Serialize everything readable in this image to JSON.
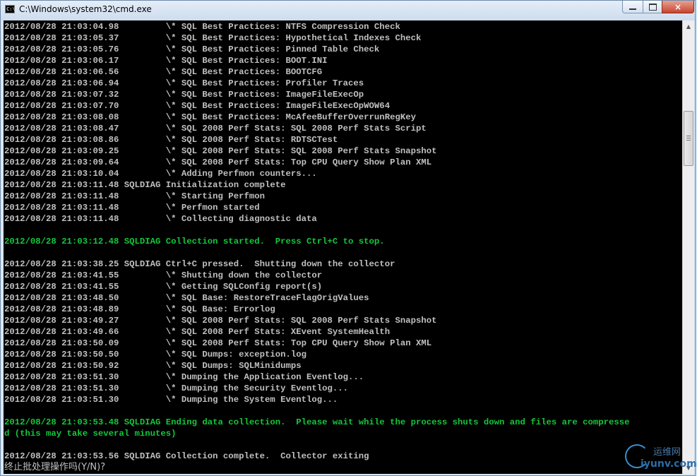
{
  "window": {
    "title": "C:\\Windows\\system32\\cmd.exe",
    "icon": "console-icon",
    "controls": {
      "minimize": "minimize-icon",
      "maximize": "maximize-icon",
      "close": "×"
    }
  },
  "console": {
    "lines": [
      {
        "text": "2012/08/28 21:03:04.98         \\* SQL Best Practices: NTFS Compression Check",
        "style": "gray"
      },
      {
        "text": "2012/08/28 21:03:05.37         \\* SQL Best Practices: Hypothetical Indexes Check",
        "style": "gray"
      },
      {
        "text": "2012/08/28 21:03:05.76         \\* SQL Best Practices: Pinned Table Check",
        "style": "gray"
      },
      {
        "text": "2012/08/28 21:03:06.17         \\* SQL Best Practices: BOOT.INI",
        "style": "gray"
      },
      {
        "text": "2012/08/28 21:03:06.56         \\* SQL Best Practices: BOOTCFG",
        "style": "gray"
      },
      {
        "text": "2012/08/28 21:03:06.94         \\* SQL Best Practices: Profiler Traces",
        "style": "gray"
      },
      {
        "text": "2012/08/28 21:03:07.32         \\* SQL Best Practices: ImageFileExecOp",
        "style": "gray"
      },
      {
        "text": "2012/08/28 21:03:07.70         \\* SQL Best Practices: ImageFileExecOpWOW64",
        "style": "gray"
      },
      {
        "text": "2012/08/28 21:03:08.08         \\* SQL Best Practices: McAfeeBufferOverrunRegKey",
        "style": "gray"
      },
      {
        "text": "2012/08/28 21:03:08.47         \\* SQL 2008 Perf Stats: SQL 2008 Perf Stats Script",
        "style": "gray"
      },
      {
        "text": "2012/08/28 21:03:08.86         \\* SQL 2008 Perf Stats: RDTSCTest",
        "style": "gray"
      },
      {
        "text": "2012/08/28 21:03:09.25         \\* SQL 2008 Perf Stats: SQL 2008 Perf Stats Snapshot",
        "style": "gray"
      },
      {
        "text": "2012/08/28 21:03:09.64         \\* SQL 2008 Perf Stats: Top CPU Query Show Plan XML",
        "style": "gray"
      },
      {
        "text": "2012/08/28 21:03:10.04         \\* Adding Perfmon counters...",
        "style": "gray"
      },
      {
        "text": "2012/08/28 21:03:11.48 SQLDIAG Initialization complete",
        "style": "gray"
      },
      {
        "text": "2012/08/28 21:03:11.48         \\* Starting Perfmon",
        "style": "gray"
      },
      {
        "text": "2012/08/28 21:03:11.48         \\* Perfmon started",
        "style": "gray"
      },
      {
        "text": "2012/08/28 21:03:11.48         \\* Collecting diagnostic data",
        "style": "gray"
      },
      {
        "text": "",
        "style": "gray"
      },
      {
        "text": "2012/08/28 21:03:12.48 SQLDIAG Collection started.  Press Ctrl+C to stop.",
        "style": "green"
      },
      {
        "text": "",
        "style": "gray"
      },
      {
        "text": "2012/08/28 21:03:38.25 SQLDIAG Ctrl+C pressed.  Shutting down the collector",
        "style": "gray"
      },
      {
        "text": "2012/08/28 21:03:41.55         \\* Shutting down the collector",
        "style": "gray"
      },
      {
        "text": "2012/08/28 21:03:41.55         \\* Getting SQLConfig report(s)",
        "style": "gray"
      },
      {
        "text": "2012/08/28 21:03:48.50         \\* SQL Base: RestoreTraceFlagOrigValues",
        "style": "gray"
      },
      {
        "text": "2012/08/28 21:03:48.89         \\* SQL Base: Errorlog",
        "style": "gray"
      },
      {
        "text": "2012/08/28 21:03:49.27         \\* SQL 2008 Perf Stats: SQL 2008 Perf Stats Snapshot",
        "style": "gray"
      },
      {
        "text": "2012/08/28 21:03:49.66         \\* SQL 2008 Perf Stats: XEvent SystemHealth",
        "style": "gray"
      },
      {
        "text": "2012/08/28 21:03:50.09         \\* SQL 2008 Perf Stats: Top CPU Query Show Plan XML",
        "style": "gray"
      },
      {
        "text": "2012/08/28 21:03:50.50         \\* SQL Dumps: exception.log",
        "style": "gray"
      },
      {
        "text": "2012/08/28 21:03:50.92         \\* SQL Dumps: SQLMinidumps",
        "style": "gray"
      },
      {
        "text": "2012/08/28 21:03:51.30         \\* Dumping the Application Eventlog...",
        "style": "gray"
      },
      {
        "text": "2012/08/28 21:03:51.30         \\* Dumping the Security Eventlog...",
        "style": "gray"
      },
      {
        "text": "2012/08/28 21:03:51.30         \\* Dumping the System Eventlog...",
        "style": "gray"
      },
      {
        "text": "",
        "style": "gray"
      },
      {
        "text": "2012/08/28 21:03:53.48 SQLDIAG Ending data collection.  Please wait while the process shuts down and files are compresse",
        "style": "green"
      },
      {
        "text": "d (this may take several minutes)",
        "style": "green"
      },
      {
        "text": "",
        "style": "gray"
      },
      {
        "text": "2012/08/28 21:03:53.56 SQLDIAG Collection complete.  Collector exiting",
        "style": "gray"
      }
    ],
    "prompt": "终止批处理操作吗(Y/N)?"
  },
  "watermark": {
    "cn": "运维网",
    "en": "iyunv.com"
  },
  "colors": {
    "console_bg": "#000000",
    "console_text": "#c0c0c0",
    "highlight_text": "#13c83a"
  }
}
